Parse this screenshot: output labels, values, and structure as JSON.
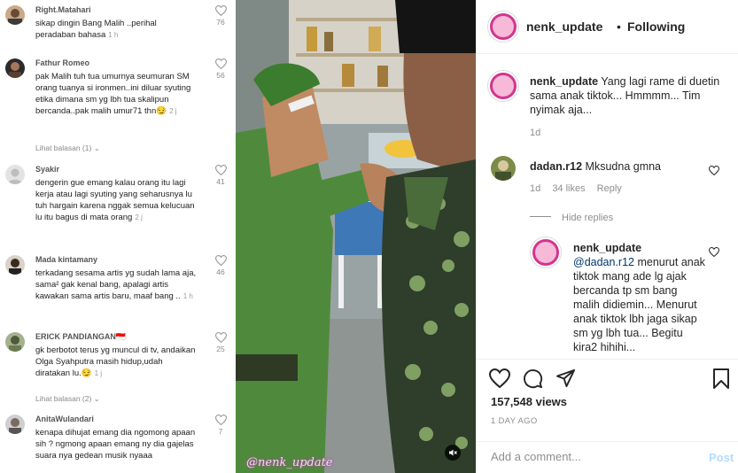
{
  "tiktok": {
    "comments": [
      {
        "user": "Right.Matahari",
        "text": "sikap dingin Bang Malih ..perihal peradaban bahasa",
        "time": "1 h",
        "likes": "76"
      },
      {
        "user": "Fathur Romeo",
        "text": "pak Malih tuh tua umurnya seumuran SM orang tuanya si ironmen..ini diluar syuting etika dimana sm yg lbh tua skalipun bercanda..pak malih umur71 thn😏",
        "time": "2 j",
        "likes": "56",
        "replies": "Lihat balasan (1)"
      },
      {
        "user": "Syakir",
        "text": "dengerin gue emang kalau orang itu lagi kerja atau lagi syuting yang seharusnya lu tuh hargain karena nggak semua kelucuan lu itu bagus di mata orang",
        "time": "2 j",
        "likes": "41"
      },
      {
        "user": "Mada kintamany",
        "text": "terkadang sesama artis yg sudah lama aja, sama² gak kenal bang, apalagi artis kawakan sama artis baru, maaf bang ..",
        "time": "1 h",
        "likes": "46"
      },
      {
        "user": "ERICK PANDIANGAN🇮🇩",
        "text": "gk berbotot terus yg muncul di tv, andaikan Olga Syahputra masih hidup,udah diratakan lu.😏",
        "time": "1 j",
        "likes": "25",
        "replies": "Lihat balasan (2)"
      },
      {
        "user": "AnitaWulandari",
        "text": "kenapa dihujat emang dia ngomong apaan sih ? ngmong apaan emang ny dia gajelas suara nya gedean musik nyaaa",
        "time": "",
        "likes": "7"
      }
    ]
  },
  "video": {
    "watermark": "@nenk_update",
    "mute_icon": "speaker-muted-icon"
  },
  "ig": {
    "header": {
      "username": "nenk_update",
      "separator": "•",
      "following": "Following"
    },
    "caption": {
      "username": "nenk_update",
      "text": "Yang lagi rame di duetin sama anak tiktok... Hmmmm... Tim nyimak aja...",
      "time": "1d"
    },
    "comments": [
      {
        "username": "dadan.r12",
        "text": "Mksudna gmna",
        "time": "1d",
        "likes": "34 likes",
        "reply_label": "Reply",
        "hide_replies": "Hide replies",
        "replies": [
          {
            "username": "nenk_update",
            "mention": "@dadan.r12",
            "text": "menurut anak tiktok mang ade lg ajak bercanda tp sm bang malih didiemin... Menurut anak tiktok lbh jaga sikap sm yg lbh tua... Begitu kira2 hihihi..."
          }
        ]
      }
    ],
    "actions": {
      "views": "157,548 views",
      "date": "1 DAY AGO"
    },
    "add_comment": {
      "placeholder": "Add a comment...",
      "post_label": "Post"
    },
    "colors": {
      "avatar_ring": "#d1368f",
      "link": "#00376b",
      "post_disabled": "#b3dbff"
    }
  }
}
